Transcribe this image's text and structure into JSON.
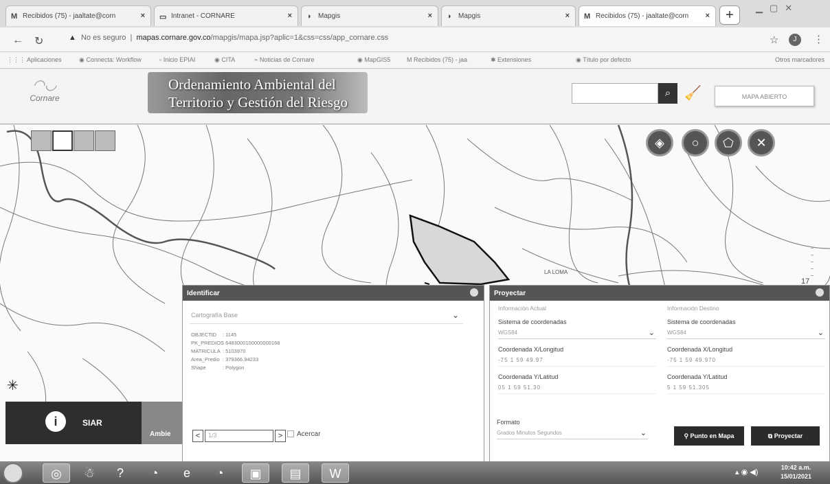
{
  "browser": {
    "tabs": [
      {
        "icon": "M",
        "title": "Recibidos (75) - jaaltate@corn"
      },
      {
        "icon": "▭",
        "title": "Intranet - CORNARE"
      },
      {
        "icon": "◑",
        "title": "Mapgis"
      },
      {
        "icon": "◑",
        "title": "Mapgis"
      },
      {
        "icon": "M",
        "title": "Recibidos (75) - jaaltate@corn"
      }
    ],
    "new_tab_label": "+",
    "address": {
      "security_label": "No es seguro",
      "domain": "mapas.cornare.gov.co",
      "path": "/mapgis/mapa.jsp?aplic=1&css=css/app_cornare.css"
    },
    "profile_initial": "J",
    "bookmarks": [
      "Aplicaciones",
      "Connecta: Workflow",
      "Inicio EPIAI",
      "CITA",
      "Noticias de Cornare",
      "MapGIS5",
      "Recibidos (75) - jaa",
      "Extensiones",
      "Título por defecto",
      "Otros marcadores"
    ]
  },
  "app": {
    "logo_text": "Cornare",
    "banner_line1": "Ordenamiento Ambiental del",
    "banner_line2": "Territorio y Gestión del Riesgo",
    "search_placeholder": "",
    "map_button_label": "MAPA ABIERTO",
    "map_label": "LA LOMA",
    "zoom_level": "17"
  },
  "tiles": {
    "siar_label": "SIAR",
    "ambiental_label": "Ambie"
  },
  "identify": {
    "title": "Identificar",
    "select_value": "Cartografía Base",
    "attributes": [
      {
        "key": "OBJECTID",
        "value": "1145"
      },
      {
        "key": "PK_PREDIOS",
        "value": "6483000100000000168"
      },
      {
        "key": "MATRICULA",
        "value": "5103970"
      },
      {
        "key": "Area_Predio",
        "value": "379366.94233"
      },
      {
        "key": "Shape",
        "value": "Polygon"
      }
    ],
    "pager_prev": "<",
    "pager_value": "1/3",
    "pager_next": ">",
    "acercar_label": "Acercar"
  },
  "project": {
    "title": "Proyectar",
    "left": {
      "subtitle": "Información Actual",
      "system_label": "Sistema de coordenadas",
      "system_value": "WGS84",
      "x_label": "Coordenada X/Longitud",
      "x_value": "-75    1    59      49.97",
      "y_label": "Coordenada Y/Latitud",
      "y_value": "05    1    59      51.30"
    },
    "right": {
      "subtitle": "Información Destino",
      "system_label": "Sistema de coordenadas",
      "system_value": "WGS84",
      "x_label": "Coordenada X/Longitud",
      "x_value": "-75    1    59      49.970",
      "y_label": "Coordenada Y/Latitud",
      "y_value": "5    1    59      51.305"
    },
    "format_label": "Formato",
    "format_value": "Grados Minutos Segundos",
    "point_button": "Punto en Mapa",
    "project_button": "Proyectar"
  },
  "taskbar": {
    "time": "10:42 a.m.",
    "date": "15/01/2021"
  }
}
